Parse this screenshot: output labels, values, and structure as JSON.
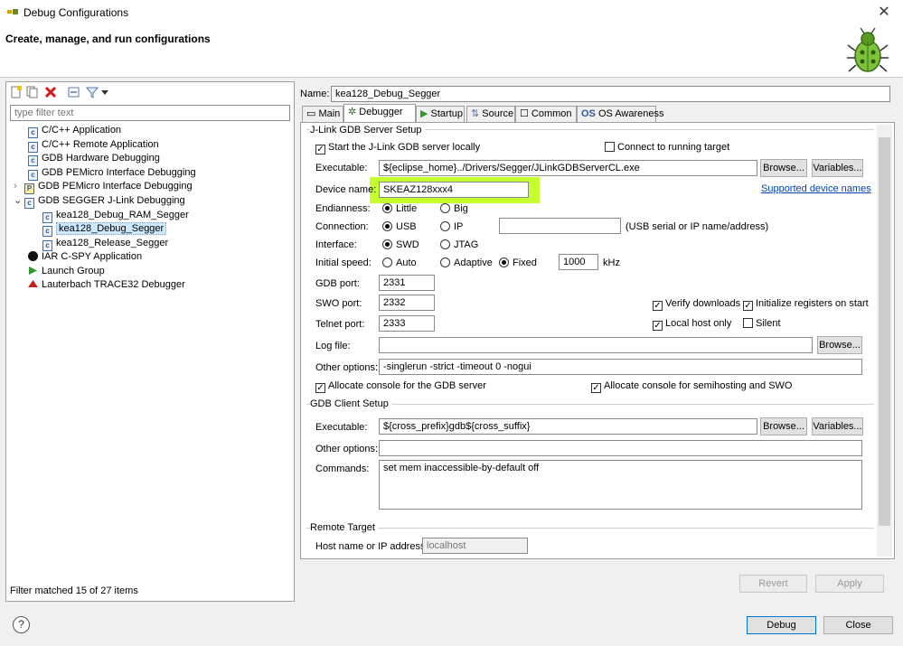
{
  "window": {
    "title": "Debug Configurations",
    "close": "✕"
  },
  "banner": {
    "title": "Create, manage, and run configurations"
  },
  "left": {
    "filter_placeholder": "type filter text",
    "tree": [
      {
        "label": "C/C++ Application",
        "icon": "c-app-icon"
      },
      {
        "label": "C/C++ Remote Application",
        "icon": "c-remote-icon"
      },
      {
        "label": "GDB Hardware Debugging",
        "icon": "gdb-hw-icon"
      },
      {
        "label": "GDB PEMicro Interface Debugging",
        "icon": "pemicro-icon"
      },
      {
        "label": "GDB PEMicro Interface Debugging",
        "icon": "pemicro-icon"
      },
      {
        "label": "GDB SEGGER J-Link Debugging",
        "icon": "segger-icon"
      },
      {
        "label": "kea128_Debug_RAM_Segger",
        "icon": "config-icon"
      },
      {
        "label": "kea128_Debug_Segger",
        "icon": "config-icon"
      },
      {
        "label": "kea128_Release_Segger",
        "icon": "config-icon"
      },
      {
        "label": "IAR C-SPY Application",
        "icon": "iar-icon"
      },
      {
        "label": "Launch Group",
        "icon": "launch-icon"
      },
      {
        "label": "Lauterbach TRACE32 Debugger",
        "icon": "trace32-icon"
      }
    ],
    "status": "Filter matched 15 of 27 items"
  },
  "config": {
    "name_label": "Name:",
    "name_value": "kea128_Debug_Segger",
    "tabs": [
      "Main",
      "Debugger",
      "Startup",
      "Source",
      "Common",
      "OS Awareness"
    ],
    "server": {
      "group_title": "J-Link GDB Server Setup",
      "start_locally": "Start the J-Link GDB server locally",
      "connect_running": "Connect to running target",
      "executable_label": "Executable:",
      "executable_value": "${eclipse_home}../Drivers/Segger/JLinkGDBServerCL.exe",
      "browse": "Browse...",
      "variables": "Variables...",
      "device_label": "Device name:",
      "device_value": "SKEAZ128xxx4",
      "supported_link": "Supported device names",
      "endian_label": "Endianness:",
      "little": "Little",
      "big": "Big",
      "connection_label": "Connection:",
      "usb": "USB",
      "ip": "IP",
      "usb_hint": "(USB serial or IP name/address)",
      "interface_label": "Interface:",
      "swd": "SWD",
      "jtag": "JTAG",
      "speed_label": "Initial speed:",
      "auto": "Auto",
      "adaptive": "Adaptive",
      "fixed": "Fixed",
      "speed_value": "1000",
      "khz": "kHz",
      "gdb_port_label": "GDB port:",
      "gdb_port": "2331",
      "swo_port_label": "SWO port:",
      "swo_port": "2332",
      "telnet_port_label": "Telnet port:",
      "telnet_port": "2333",
      "verify": "Verify downloads",
      "init_regs": "Initialize registers on start",
      "local_host": "Local host only",
      "silent": "Silent",
      "log_label": "Log file:",
      "other_label": "Other options:",
      "other_value": "-singlerun -strict -timeout 0 -nogui",
      "alloc_gdb": "Allocate console for the GDB server",
      "alloc_semi": "Allocate console for semihosting and SWO"
    },
    "client": {
      "group_title": "GDB Client Setup",
      "executable_label": "Executable:",
      "executable_value": "${cross_prefix}gdb${cross_suffix}",
      "other_label": "Other options:",
      "commands_label": "Commands:",
      "commands_value": "set mem inaccessible-by-default off"
    },
    "remote": {
      "group_title": "Remote Target",
      "host_label": "Host name or IP address:",
      "host_value": "localhost"
    },
    "revert": "Revert",
    "apply": "Apply"
  },
  "footer": {
    "debug": "Debug",
    "close": "Close",
    "help": "?"
  },
  "colors": {
    "highlight": "#c6ff2e",
    "selection": "#cce8ff",
    "link": "#0645ad"
  }
}
